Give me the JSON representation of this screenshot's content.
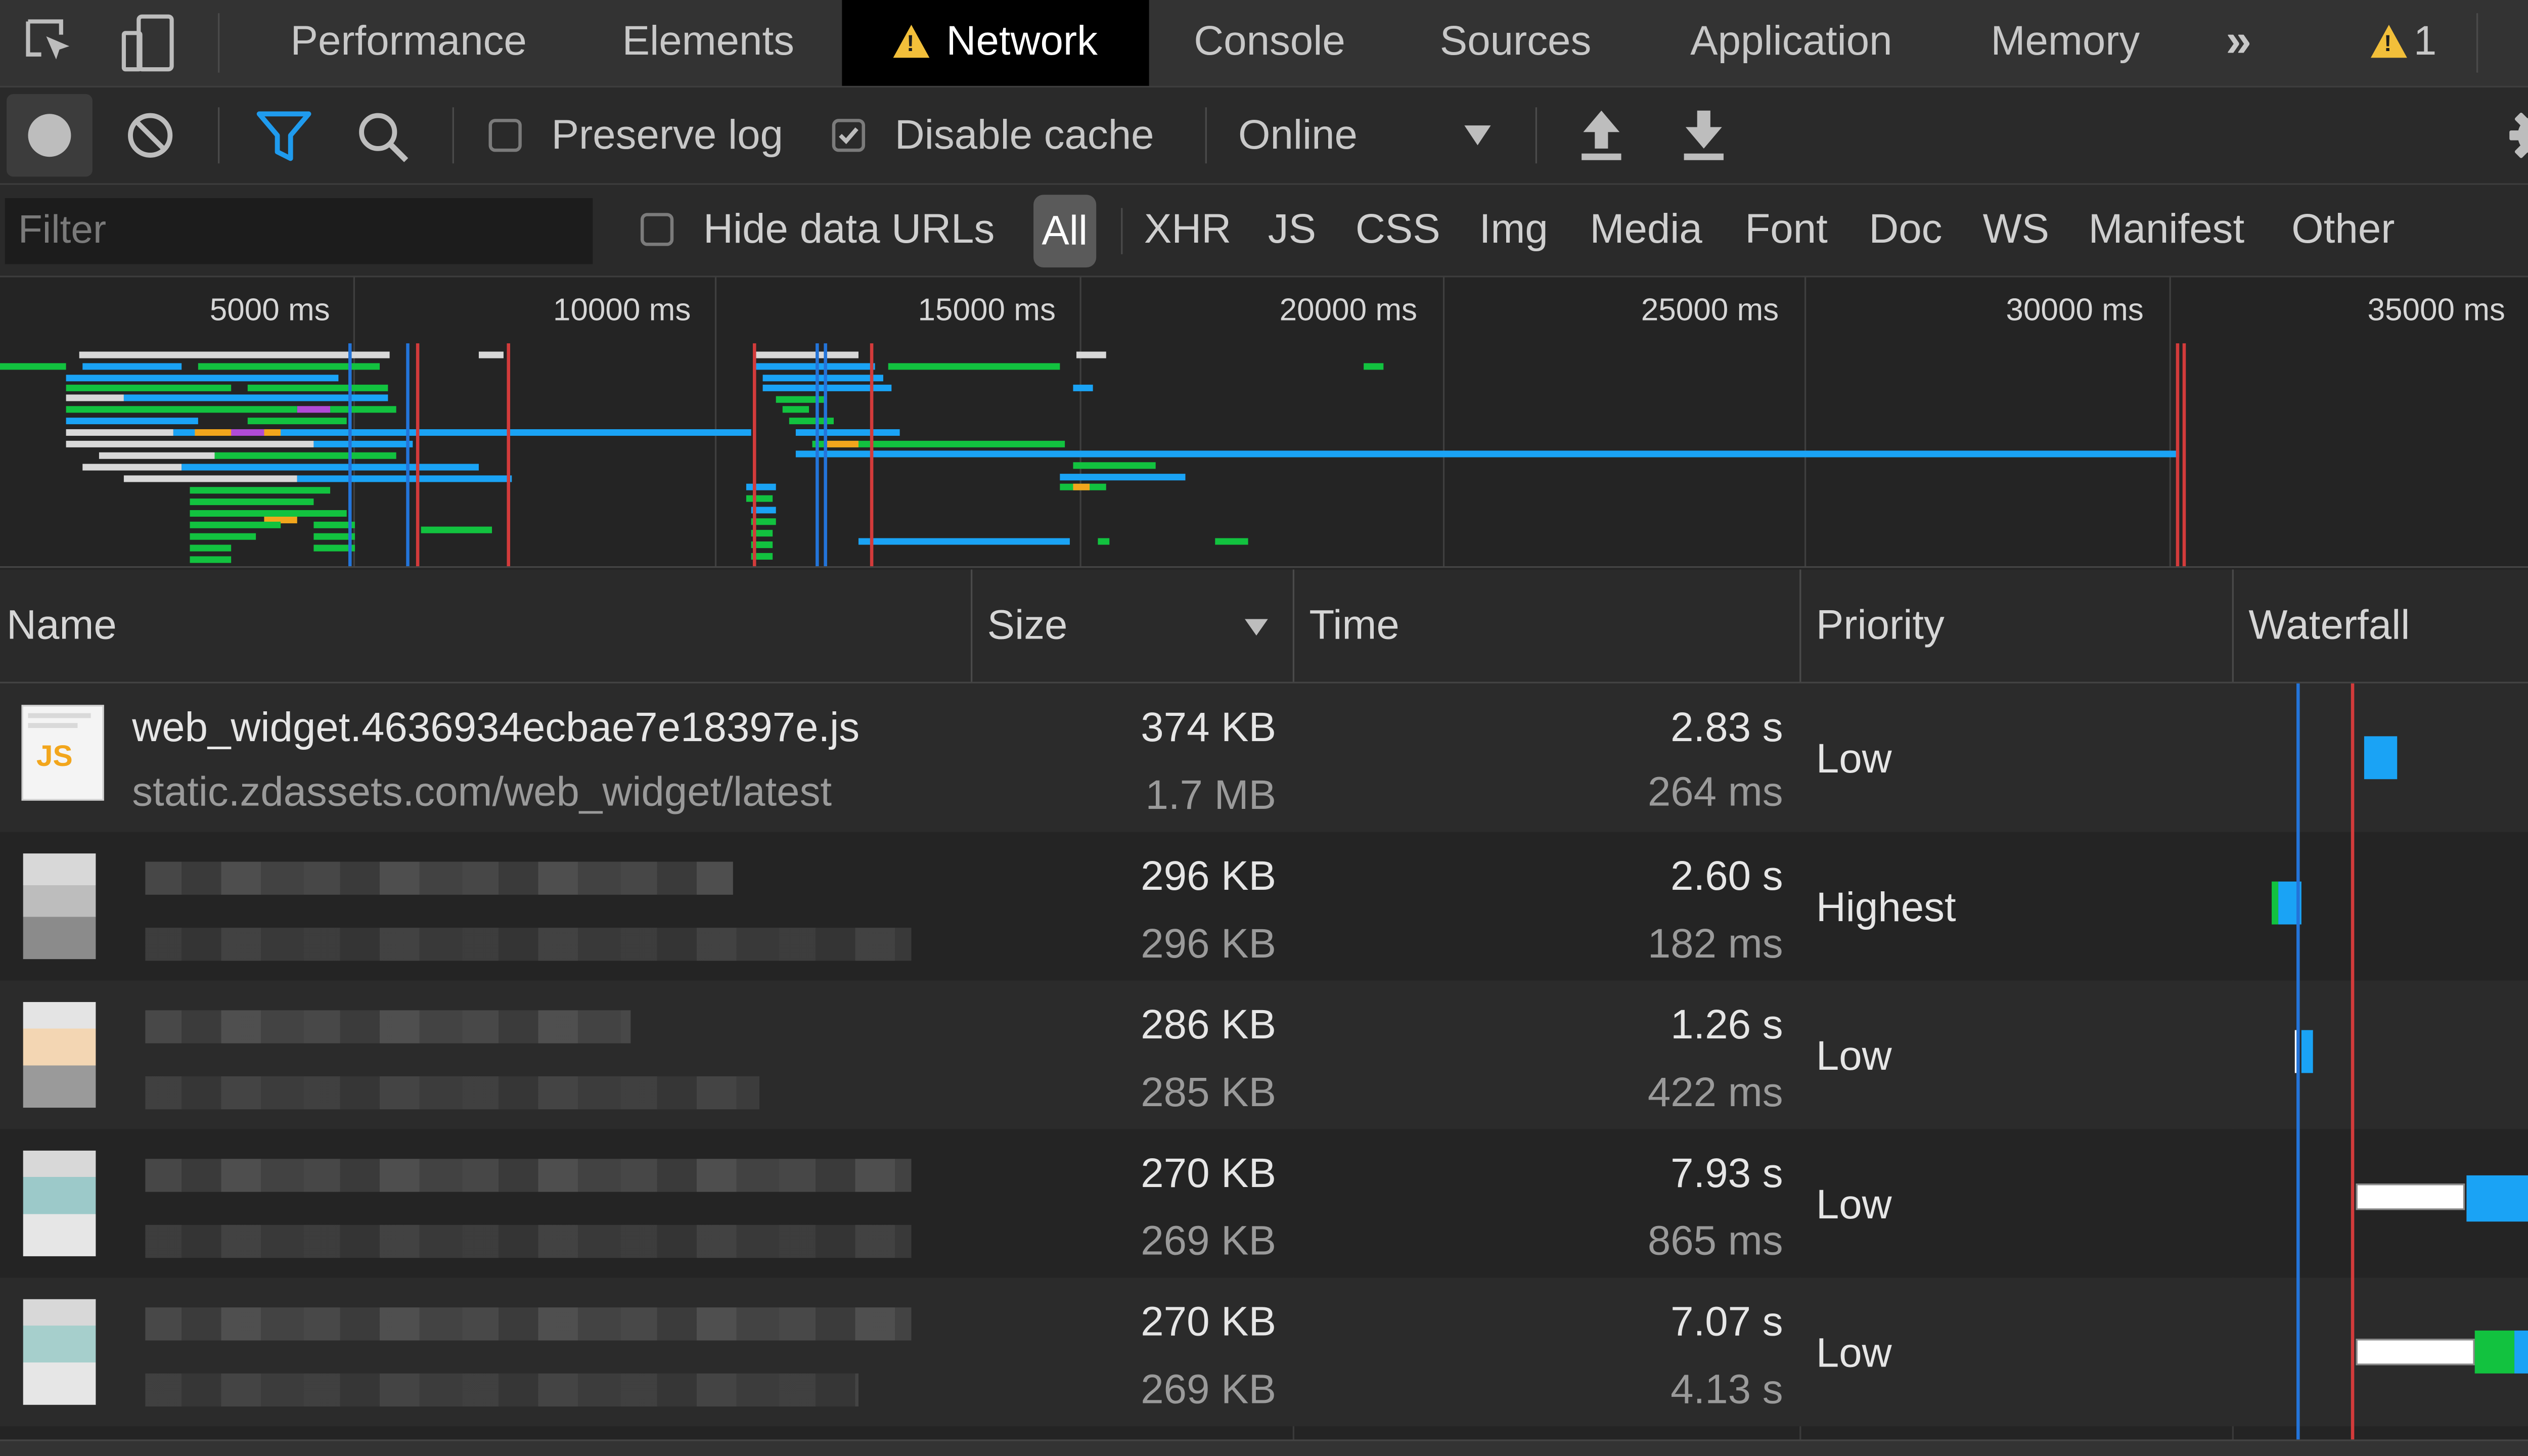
{
  "tabs": [
    {
      "label": "Performance"
    },
    {
      "label": "Elements"
    },
    {
      "label": "Network"
    },
    {
      "label": "Console"
    },
    {
      "label": "Sources"
    },
    {
      "label": "Application"
    },
    {
      "label": "Memory"
    }
  ],
  "more_tabs": "»",
  "warning_count": "1",
  "toolbar": {
    "preserve_log": "Preserve log",
    "preserve_log_checked": false,
    "disable_cache": "Disable cache",
    "disable_cache_checked": true,
    "throttling": "Online"
  },
  "filter": {
    "placeholder": "Filter",
    "hide_data_urls": "Hide data URLs",
    "types": [
      "All",
      "XHR",
      "JS",
      "CSS",
      "Img",
      "Media",
      "Font",
      "Doc",
      "WS",
      "Manifest",
      "Other"
    ],
    "selected_type": "All"
  },
  "overview": {
    "ticks": [
      "5000 ms",
      "10000 ms",
      "15000 ms",
      "20000 ms",
      "25000 ms",
      "30000 ms",
      "35000 ms"
    ]
  },
  "columns": {
    "name": "Name",
    "size": "Size",
    "time": "Time",
    "priority": "Priority",
    "waterfall": "Waterfall"
  },
  "rows": [
    {
      "name": "web_widget.4636934ecbae7e18397e.js",
      "url": "static.zdassets.com/web_widget/latest",
      "size": "374 KB",
      "resource_size": "1.7 MB",
      "time": "2.83 s",
      "latency": "264 ms",
      "priority": "Low",
      "thumb": "JS"
    },
    {
      "name": "",
      "url": "",
      "size": "296 KB",
      "resource_size": "296 KB",
      "time": "2.60 s",
      "latency": "182 ms",
      "priority": "Highest"
    },
    {
      "name": "",
      "url": "",
      "size": "286 KB",
      "resource_size": "285 KB",
      "time": "1.26 s",
      "latency": "422 ms",
      "priority": "Low"
    },
    {
      "name": "",
      "url": "",
      "size": "270 KB",
      "resource_size": "269 KB",
      "time": "7.93 s",
      "latency": "865 ms",
      "priority": "Low"
    },
    {
      "name": "",
      "url": "",
      "size": "270 KB",
      "resource_size": "269 KB",
      "time": "7.07 s",
      "latency": "4.13 s",
      "priority": "Low"
    }
  ],
  "colors": {
    "waiting": "#ffffff",
    "downloading": "#1aa3f5",
    "queueing": "#12c23f",
    "dom_content_loaded": "#2374d9",
    "load": "#d33b3b"
  }
}
